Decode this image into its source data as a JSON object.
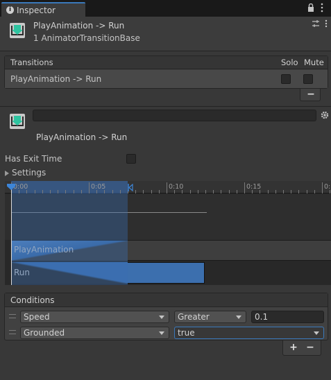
{
  "tab": {
    "label": "Inspector",
    "icon": "info-icon"
  },
  "header": {
    "title": "PlayAnimation -> Run",
    "subtitle": "1 AnimatorTransitionBase",
    "icon": "transition-icon"
  },
  "transitions": {
    "header_label": "Transitions",
    "solo_label": "Solo",
    "mute_label": "Mute",
    "rows": [
      {
        "label": "PlayAnimation -> Run",
        "solo": false,
        "mute": false
      }
    ],
    "remove_label": "−"
  },
  "settings": {
    "name_field_value": "",
    "transition_name": "PlayAnimation -> Run",
    "has_exit_time_label": "Has Exit Time",
    "has_exit_time": false,
    "settings_foldout_label": "Settings"
  },
  "timeline": {
    "ticks": [
      "0:00",
      "0:05",
      "0:10",
      "0:15",
      "0:"
    ],
    "tracks": [
      "PlayAnimation",
      "Run"
    ]
  },
  "conditions": {
    "header_label": "Conditions",
    "rows": [
      {
        "parameter": "Speed",
        "mode": "Greater",
        "value": "0.1"
      },
      {
        "parameter": "Grounded",
        "mode": "true"
      }
    ],
    "add_label": "+",
    "remove_label": "−"
  },
  "colors": {
    "accent": "#3a79bb",
    "timeline_blue": "#3c6fae",
    "icon_teal": "#2ec4a0"
  }
}
